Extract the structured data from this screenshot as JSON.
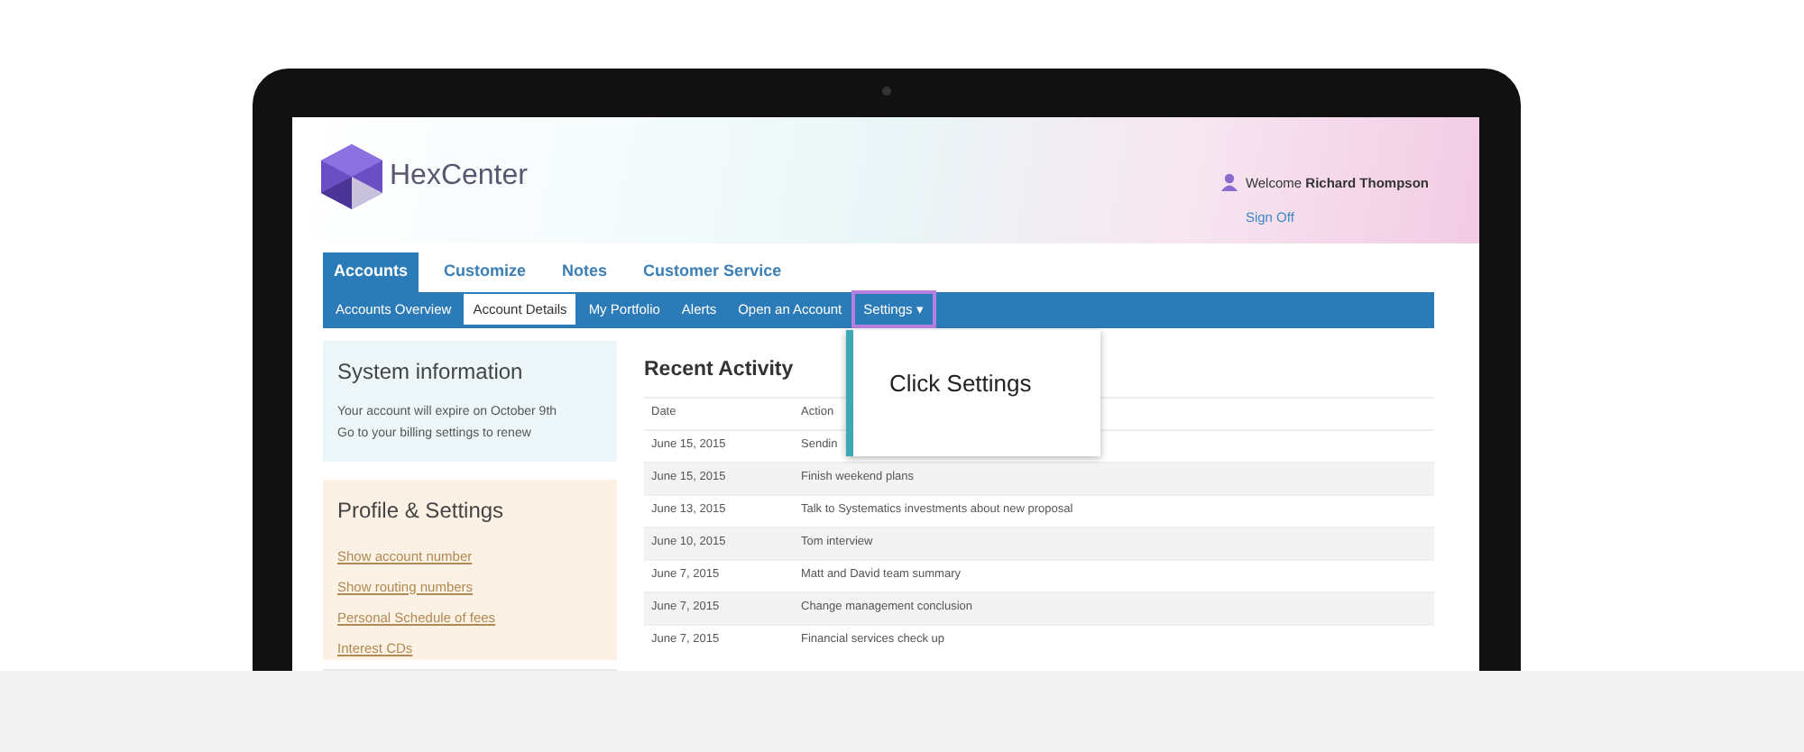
{
  "brand": {
    "name": "HexCenter"
  },
  "user": {
    "greeting": "Welcome",
    "name": "Richard Thompson",
    "sign_off": "Sign Off"
  },
  "tabs": [
    {
      "label": "Accounts",
      "selected": true
    },
    {
      "label": "Customize",
      "selected": false
    },
    {
      "label": "Notes",
      "selected": false
    },
    {
      "label": "Customer Service",
      "selected": false
    }
  ],
  "subnav": [
    {
      "label": "Accounts Overview",
      "selected": false,
      "highlighted": false
    },
    {
      "label": "Account Details",
      "selected": true,
      "highlighted": false
    },
    {
      "label": "My Portfolio",
      "selected": false,
      "highlighted": false
    },
    {
      "label": "Alerts",
      "selected": false,
      "highlighted": false
    },
    {
      "label": "Open an Account",
      "selected": false,
      "highlighted": false
    },
    {
      "label": "Settings",
      "caret": "▾",
      "selected": false,
      "highlighted": true
    }
  ],
  "system_info": {
    "title": "System information",
    "lines": [
      "Your account will expire on October 9th",
      "Go to your billing settings to renew"
    ]
  },
  "profile": {
    "title": "Profile & Settings",
    "links": [
      "Show account number",
      "Show routing numbers",
      "Personal Schedule of fees",
      "Interest CDs"
    ]
  },
  "activity": {
    "title": "Recent Activity",
    "columns": [
      "Date",
      "Action"
    ],
    "rows": [
      {
        "date": "June 15, 2015",
        "action": "Sendin"
      },
      {
        "date": "June 15, 2015",
        "action": "Finish weekend plans"
      },
      {
        "date": "June 13, 2015",
        "action": "Talk to Systematics investments about new proposal"
      },
      {
        "date": "June 10, 2015",
        "action": "Tom interview"
      },
      {
        "date": "June 7, 2015",
        "action": "Matt and David team summary"
      },
      {
        "date": "June 7, 2015",
        "action": "Change management conclusion"
      },
      {
        "date": "June 7, 2015",
        "action": "Financial services check up"
      }
    ]
  },
  "tooltip": {
    "text": "Click Settings"
  }
}
